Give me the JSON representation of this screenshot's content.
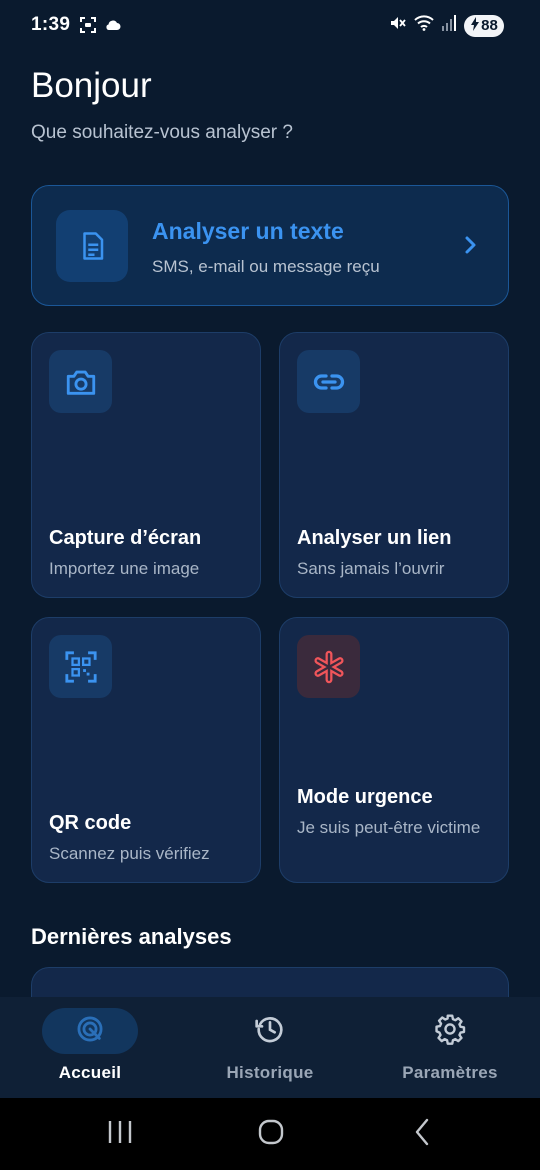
{
  "status_bar": {
    "time": "1:39",
    "battery": "88",
    "icons": [
      "screenshot-icon",
      "cloud-icon",
      "mute-icon",
      "wifi-icon",
      "signal-icon",
      "battery-charging-icon"
    ]
  },
  "header": {
    "greeting": "Bonjour",
    "subtitle": "Que souhaitez-vous analyser ?"
  },
  "hero": {
    "title": "Analyser un texte",
    "subtitle": "SMS, e-mail ou message reçu",
    "icon": "document-icon"
  },
  "cards": [
    {
      "title": "Capture d’écran",
      "subtitle": "Importez une image",
      "icon": "camera-icon"
    },
    {
      "title": "Analyser un lien",
      "subtitle": "Sans jamais l’ouvrir",
      "icon": "link-icon"
    },
    {
      "title": "QR code",
      "subtitle": "Scannez puis vérifiez",
      "icon": "qr-scan-icon"
    },
    {
      "title": "Mode urgence",
      "subtitle": "Je suis peut-être victime",
      "icon": "emergency-asterisk-icon"
    }
  ],
  "recent": {
    "title": "Dernières analyses"
  },
  "bottom_nav": [
    {
      "label": "Accueil",
      "icon": "radar-icon",
      "active": true
    },
    {
      "label": "Historique",
      "icon": "history-icon",
      "active": false
    },
    {
      "label": "Paramètres",
      "icon": "settings-gear-icon",
      "active": false
    }
  ],
  "colors": {
    "background": "#0a1a2e",
    "accent": "#3b93f0",
    "card": "#13284a",
    "danger": "#f0555a"
  }
}
